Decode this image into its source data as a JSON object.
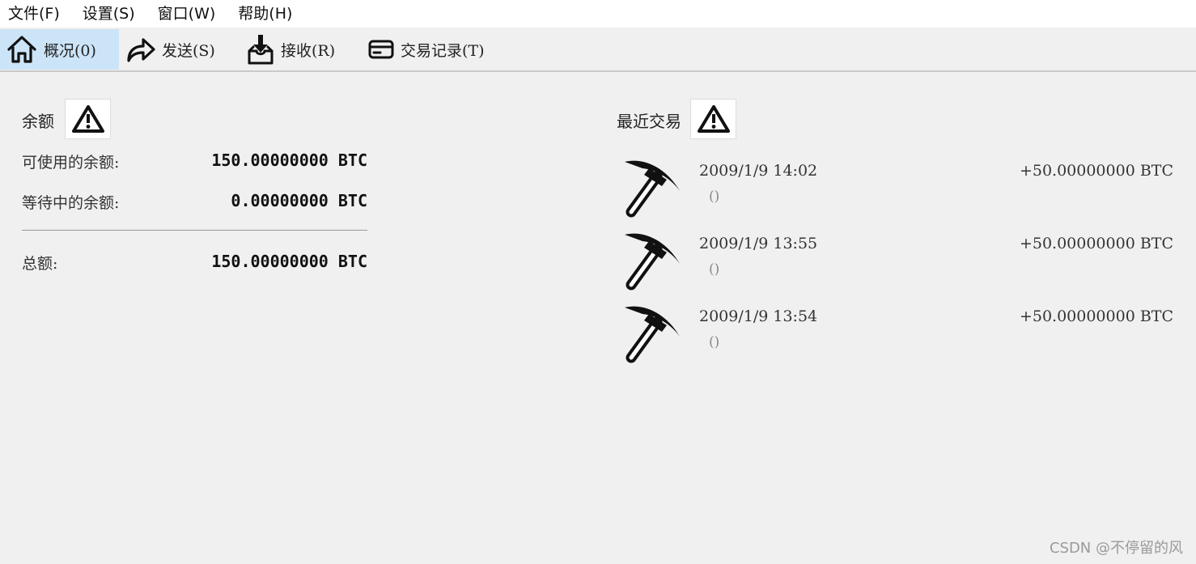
{
  "menu": [
    "文件(F)",
    "设置(S)",
    "窗口(W)",
    "帮助(H)"
  ],
  "tabs": [
    {
      "label": "概况(0)",
      "icon": "home-icon",
      "active": true
    },
    {
      "label": "发送(S)",
      "icon": "send-arrow-icon",
      "active": false
    },
    {
      "label": "接收(R)",
      "icon": "receive-inbox-icon",
      "active": false
    },
    {
      "label": "交易记录(T)",
      "icon": "card-icon",
      "active": false
    }
  ],
  "balance": {
    "title": "余额",
    "available_label": "可使用的余额:",
    "available_value": "150.00000000 BTC",
    "pending_label": "等待中的余额:",
    "pending_value": "0.00000000 BTC",
    "total_label": "总额:",
    "total_value": "150.00000000 BTC"
  },
  "recent": {
    "title": "最近交易",
    "transactions": [
      {
        "date": "2009/1/9 14:02",
        "address": "()",
        "amount": "+50.00000000 BTC",
        "icon": "pickaxe-mined-icon"
      },
      {
        "date": "2009/1/9 13:55",
        "address": "()",
        "amount": "+50.00000000 BTC",
        "icon": "pickaxe-mined-icon"
      },
      {
        "date": "2009/1/9 13:54",
        "address": "()",
        "amount": "+50.00000000 BTC",
        "icon": "pickaxe-mined-icon"
      }
    ]
  },
  "watermark": "CSDN @不停留的风"
}
